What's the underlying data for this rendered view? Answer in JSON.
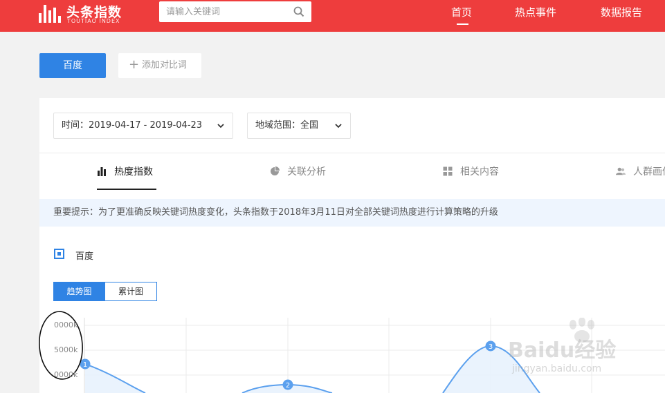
{
  "header": {
    "logo_title": "头条指数",
    "logo_subtitle": "TOUTIAO INDEX",
    "search_placeholder": "请输入关键词",
    "nav": [
      "首页",
      "热点事件",
      "数据报告"
    ]
  },
  "compare": {
    "keyword": "百度",
    "add_label": "添加对比词"
  },
  "filters": {
    "time": "时间：2019-04-17 - 2019-04-23",
    "region": "地域范围：全国"
  },
  "tabs": [
    {
      "label": "热度指数",
      "icon": "bar-chart-icon",
      "active": true
    },
    {
      "label": "关联分析",
      "icon": "pie-chart-icon",
      "active": false
    },
    {
      "label": "相关内容",
      "icon": "grid-icon",
      "active": false
    },
    {
      "label": "人群画像",
      "icon": "users-icon",
      "active": false
    }
  ],
  "notice": "重要提示：为了更准确反映关键词热度变化，头条指数于2018年3月11日对全部关键词热度进行计算策略的升级",
  "legend": {
    "label": "百度"
  },
  "view_toggle": {
    "trend": "趋势图",
    "cumulative": "累计图"
  },
  "chart_data": {
    "type": "area",
    "series": [
      {
        "name": "百度",
        "values": [
          null,
          null,
          null
        ]
      }
    ],
    "points": [
      {
        "label": "1"
      },
      {
        "label": "2"
      },
      {
        "label": "3"
      }
    ],
    "y_tick_labels": [
      "0000k",
      "5000k",
      "0000k"
    ],
    "grid": true,
    "color": "#5ba0ee"
  },
  "watermark": {
    "text": "Baidu经验",
    "url": "jingyan.baidu.com"
  },
  "colors": {
    "brand_red": "#ee3d3d",
    "accent_blue": "#2f83e4",
    "notice_bg": "#eef5fe"
  }
}
